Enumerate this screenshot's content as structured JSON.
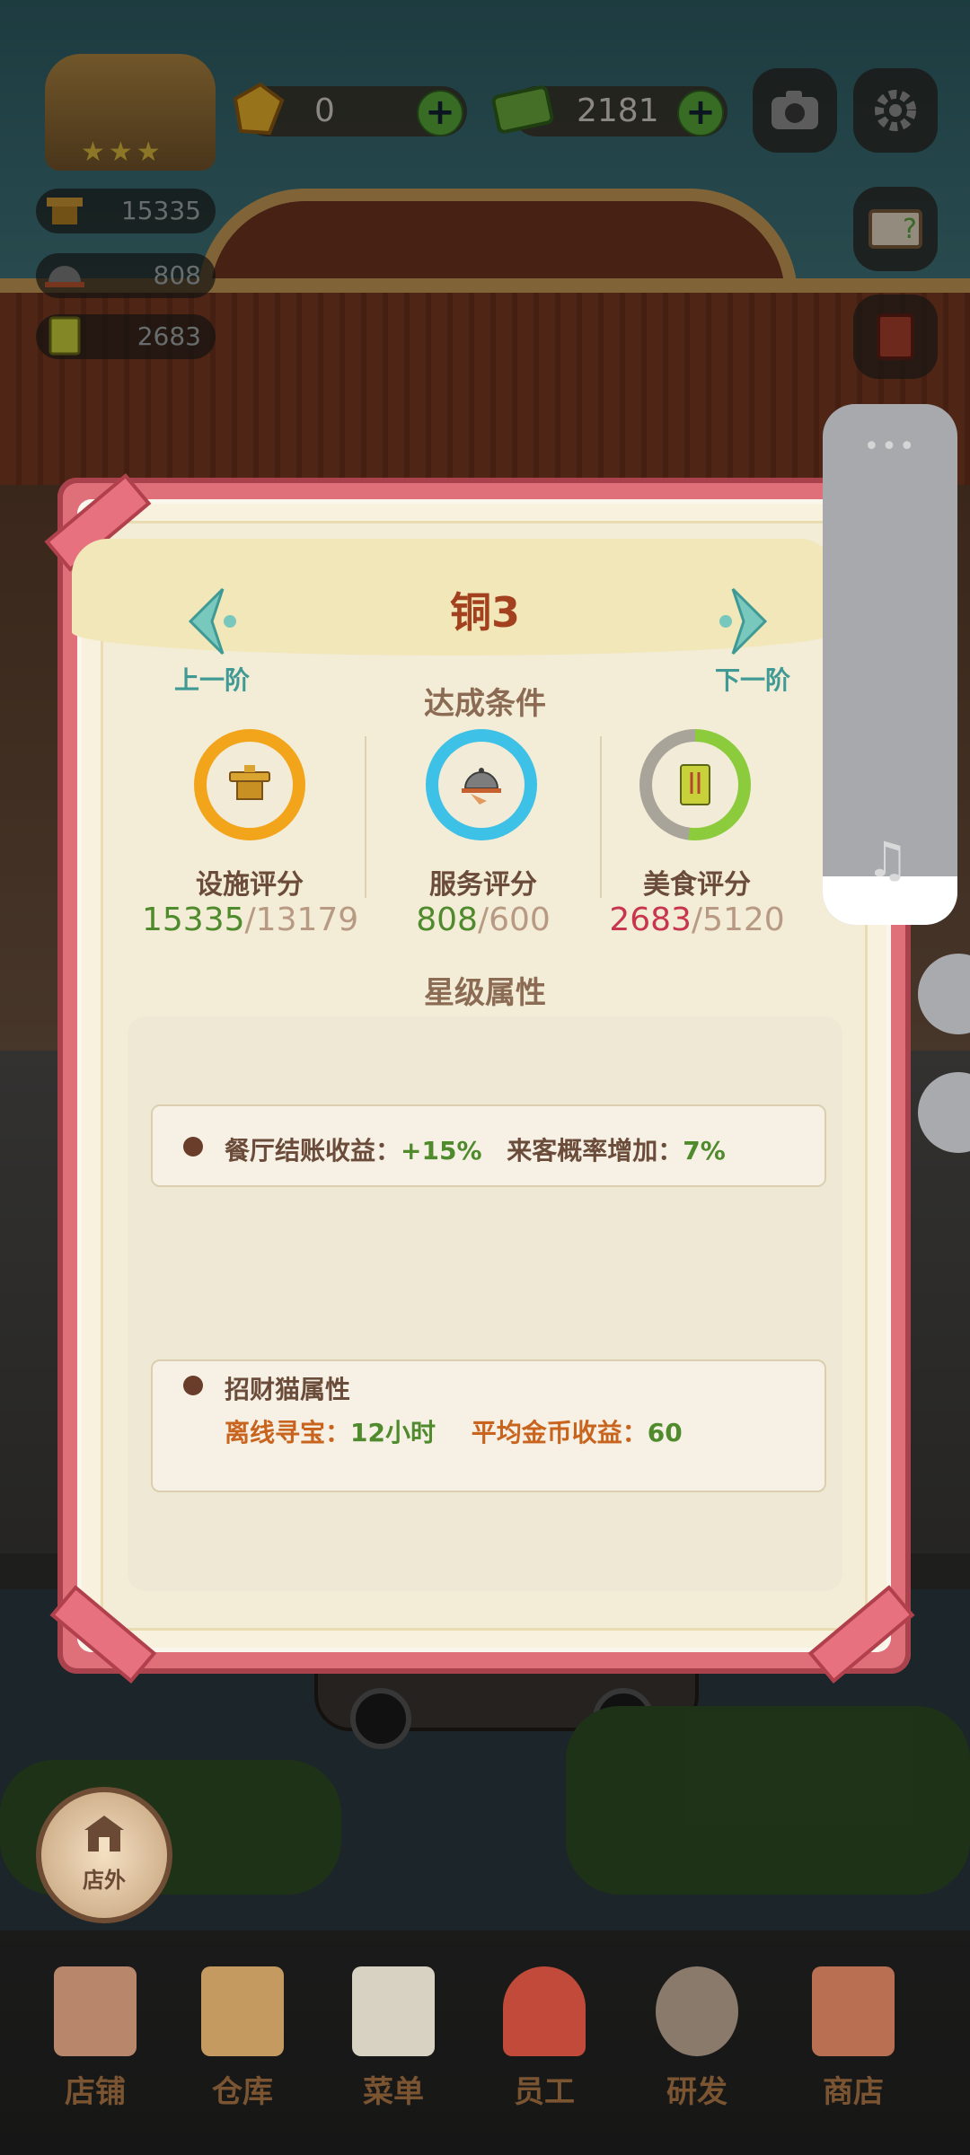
{
  "hud": {
    "gems": "0",
    "money": "2181",
    "facility_score": "15335",
    "service_score": "808",
    "food_score": "2683"
  },
  "modal": {
    "title": "铜3",
    "prev_label": "上一阶",
    "next_label": "下一阶",
    "conditions_title": "达成条件",
    "requirements": [
      {
        "label": "设施评分",
        "current": "15335",
        "target": "/13179",
        "ring_color": "#f2a51b",
        "current_color": "#4f8a2d"
      },
      {
        "label": "服务评分",
        "current": "808",
        "target": "/600",
        "ring_color": "#3ec1e6",
        "current_color": "#4f8a2d"
      },
      {
        "label": "美食评分",
        "current": "2683",
        "target": "/5120",
        "ring_color": "#8ccc3c",
        "current_color": "#c8364d",
        "ring_progress": 0.52
      }
    ],
    "attributes_title": "星级属性",
    "restaurant_bonus": {
      "label1": "餐厅结账收益：",
      "value1": "+15%",
      "label2": "来客概率增加：",
      "value2": "7%"
    },
    "lucky_cat": {
      "title": "招财猫属性",
      "label1": "离线寻宝：",
      "value1": "12小时",
      "label2": "平均金币收益：",
      "value2": "60"
    }
  },
  "side_panel": {
    "dots": "•••",
    "music_icon": "♫"
  },
  "bottom": {
    "outside_label": "店外",
    "menu": [
      {
        "label": "店铺",
        "color": "#b8866a"
      },
      {
        "label": "仓库",
        "color": "#c59a60"
      },
      {
        "label": "菜单",
        "color": "#d8d2c2"
      },
      {
        "label": "员工",
        "color": "#c24a3a"
      },
      {
        "label": "研发",
        "color": "#8a7a6c"
      },
      {
        "label": "商店",
        "color": "#b86f52"
      }
    ]
  }
}
